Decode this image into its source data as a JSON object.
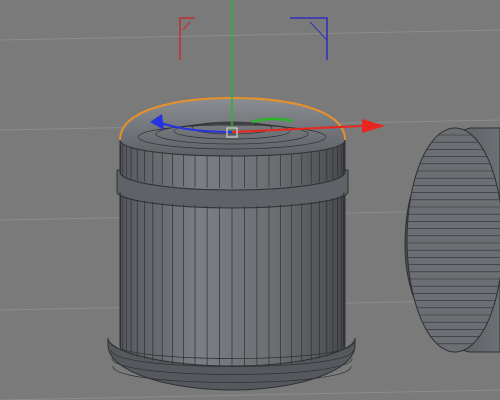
{
  "viewport": {
    "name": "3D viewport",
    "background_color": "#7a7a7a",
    "grid_color": "#8c8c8c"
  },
  "selected_object": {
    "name": "jar-cap",
    "selection_outline_color": "#e8902a",
    "mesh_color": "#6b6e72",
    "wire_color": "#2e3034"
  },
  "gizmo": {
    "x_axis_color": "#e8261e",
    "y_axis_color": "#2bb52b",
    "z_axis_color": "#2633e0",
    "pivot_color": "#d0d0d0"
  },
  "view_brackets": {
    "left_color": "#c03030",
    "right_color": "#3030c0"
  },
  "secondary_object": {
    "name": "cylinder-side",
    "mesh_color": "#6b6e72"
  }
}
